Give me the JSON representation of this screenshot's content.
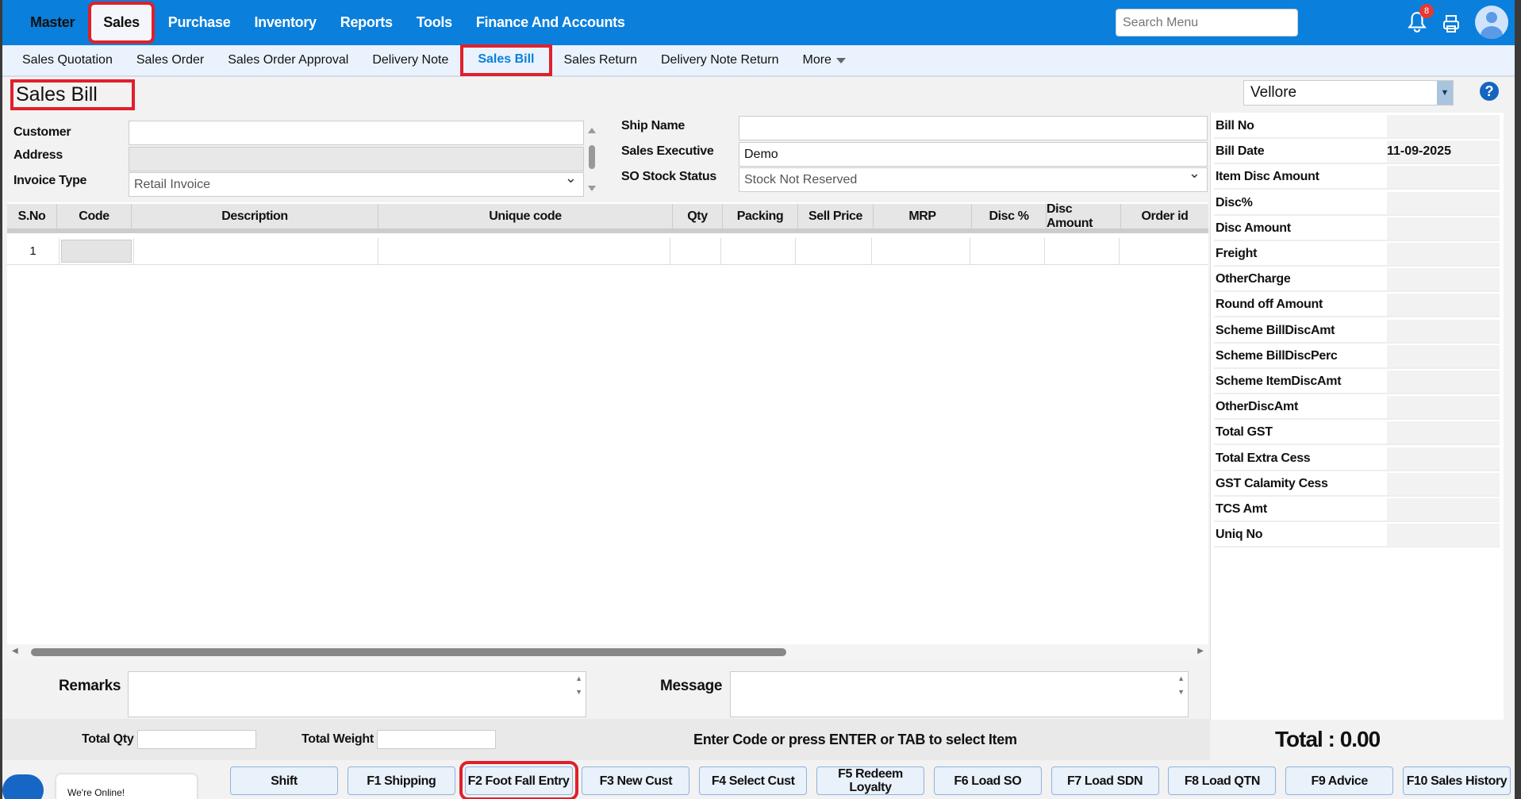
{
  "topnav": {
    "items": [
      "Master",
      "Sales",
      "Purchase",
      "Inventory",
      "Reports",
      "Tools",
      "Finance And Accounts"
    ],
    "active": "Sales",
    "search_placeholder": "Search Menu",
    "notification_count": "8"
  },
  "subnav": {
    "items": [
      "Sales Quotation",
      "Sales Order",
      "Sales Order Approval",
      "Delivery Note",
      "Sales Bill",
      "Sales Return",
      "Delivery Note Return",
      "More"
    ],
    "active": "Sales Bill"
  },
  "page": {
    "title": "Sales Bill",
    "branch": "Vellore",
    "help": "?"
  },
  "form": {
    "customer_label": "Customer",
    "customer_value": "",
    "address_label": "Address",
    "invoice_type_label": "Invoice Type",
    "invoice_type_value": "Retail Invoice",
    "ship_name_label": "Ship Name",
    "ship_name_value": "",
    "sales_exec_label": "Sales Executive",
    "sales_exec_value": "Demo",
    "so_stock_label": "SO Stock Status",
    "so_stock_value": "Stock Not Reserved"
  },
  "grid": {
    "columns": [
      "S.No",
      "Code",
      "Description",
      "Unique code",
      "Qty",
      "Packing",
      "Sell Price",
      "MRP",
      "Disc %",
      "Disc Amount",
      "Order id"
    ],
    "rows": [
      {
        "sno": "1"
      }
    ]
  },
  "summary": [
    {
      "label": "Bill No",
      "value": ""
    },
    {
      "label": "Bill Date",
      "value": "11-09-2025"
    },
    {
      "label": "Item Disc Amount",
      "value": ""
    },
    {
      "label": "Disc%",
      "value": ""
    },
    {
      "label": "Disc Amount",
      "value": ""
    },
    {
      "label": "Freight",
      "value": ""
    },
    {
      "label": "OtherCharge",
      "value": ""
    },
    {
      "label": "Round off Amount",
      "value": ""
    },
    {
      "label": "Scheme BillDiscAmt",
      "value": ""
    },
    {
      "label": "Scheme BillDiscPerc",
      "value": ""
    },
    {
      "label": "Scheme ItemDiscAmt",
      "value": ""
    },
    {
      "label": "OtherDiscAmt",
      "value": ""
    },
    {
      "label": "Total GST",
      "value": ""
    },
    {
      "label": "Total Extra Cess",
      "value": ""
    },
    {
      "label": "GST Calamity Cess",
      "value": ""
    },
    {
      "label": "TCS Amt",
      "value": ""
    },
    {
      "label": "Uniq No",
      "value": ""
    }
  ],
  "footer": {
    "remarks_label": "Remarks",
    "message_label": "Message",
    "total_qty_label": "Total Qty",
    "total_weight_label": "Total Weight",
    "hint": "Enter Code or press ENTER or TAB to select Item",
    "total": "Total : 0.00",
    "chat_status": "We're Online!"
  },
  "buttons": [
    "Shift",
    "F1 Shipping",
    "F2 Foot Fall Entry",
    "F3 New Cust",
    "F4 Select Cust",
    "F5 Redeem Loyalty",
    "F6 Load SO",
    "F7 Load SDN",
    "F8 Load QTN",
    "F9 Advice",
    "F10 Sales History"
  ]
}
